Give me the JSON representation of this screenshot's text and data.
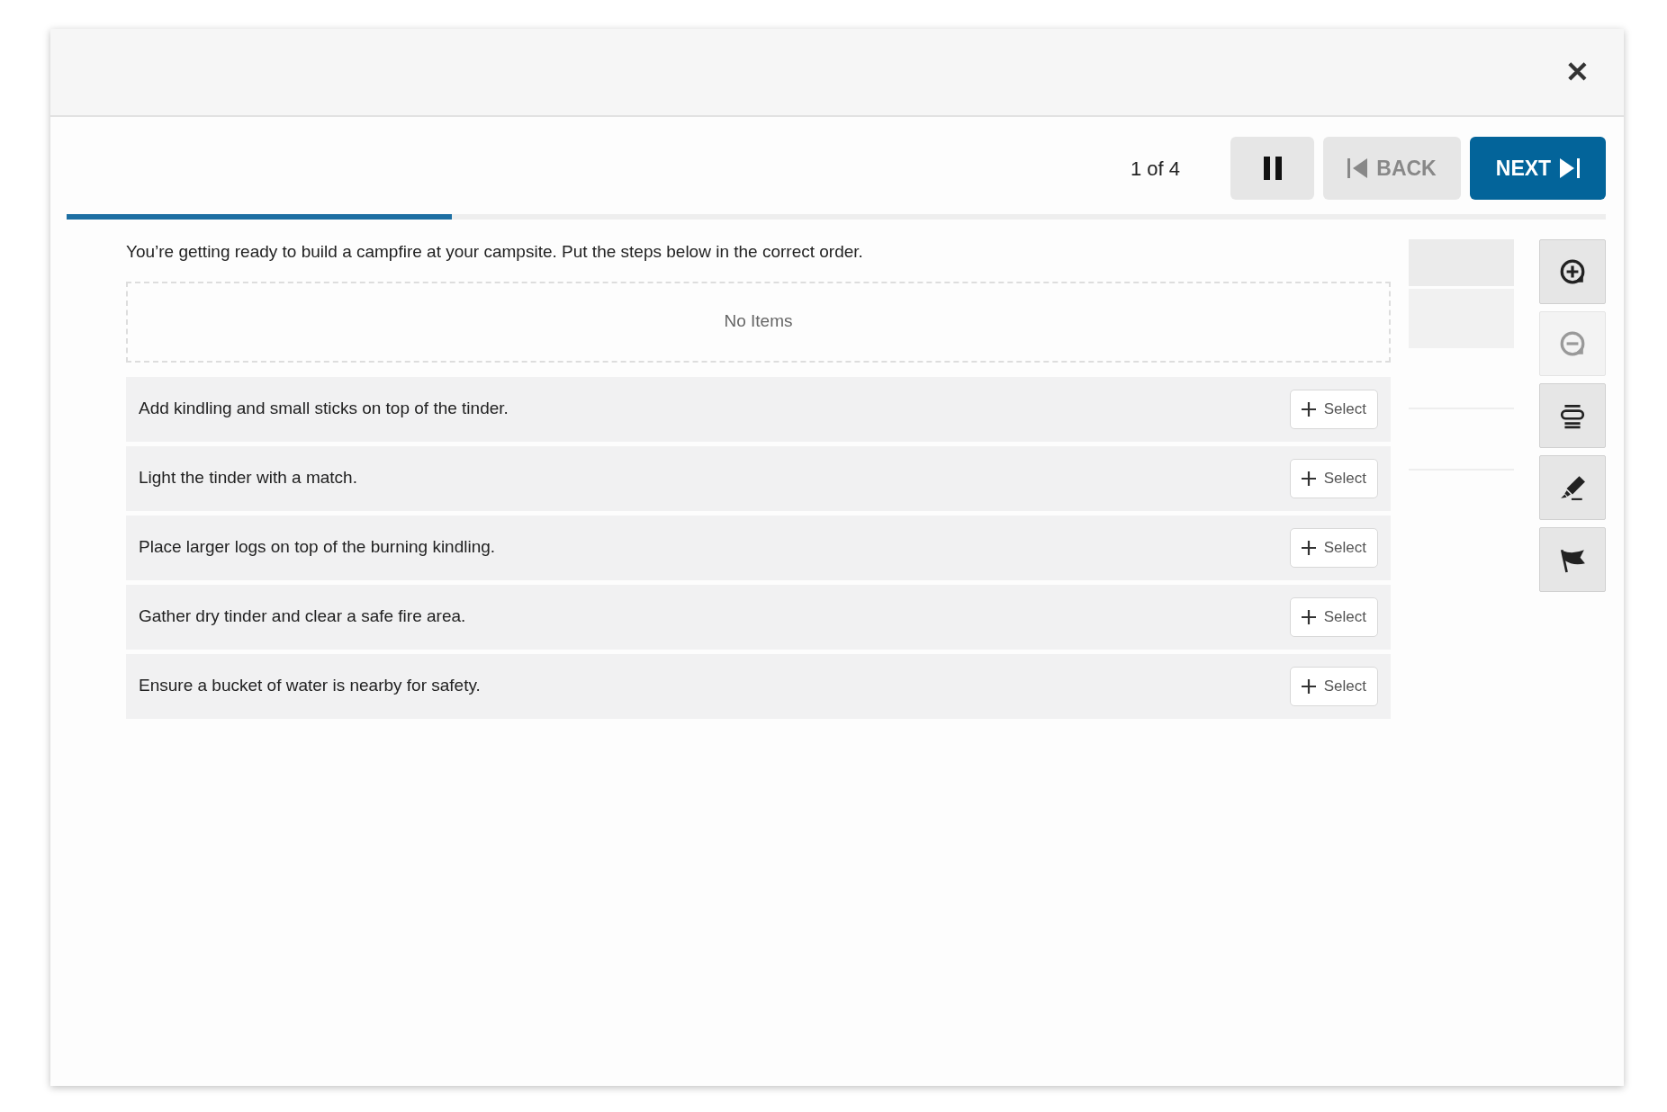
{
  "header": {
    "close": "✕"
  },
  "navigation": {
    "position": "1 of 4",
    "back": {
      "label": "BACK",
      "disabled": true
    },
    "next": {
      "label": "NEXT",
      "disabled": false
    }
  },
  "progress": {
    "level": 0.25
  },
  "question": {
    "prompt": "You’re getting ready to build a campfire at your campsite. Put the steps below in the correct order.",
    "dropzone": "No Items",
    "options": [
      {
        "text": "Add kindling and small sticks on top of the tinder.",
        "action": "Select"
      },
      {
        "text": "Light the tinder with a match.",
        "action": "Select"
      },
      {
        "text": "Place larger logs on top of the burning kindling.",
        "action": "Select"
      },
      {
        "text": "Gather dry tinder and clear a safe fire area.",
        "action": "Select"
      },
      {
        "text": "Ensure a bucket of water is nearby for safety.",
        "action": "Select"
      }
    ]
  },
  "tools": [
    {
      "kind": "zoom-in",
      "disabled": false
    },
    {
      "kind": "zoom-out",
      "disabled": true
    },
    {
      "kind": "line-reader",
      "disabled": false
    },
    {
      "kind": "highlighter",
      "disabled": false
    },
    {
      "kind": "flag",
      "disabled": false
    }
  ]
}
